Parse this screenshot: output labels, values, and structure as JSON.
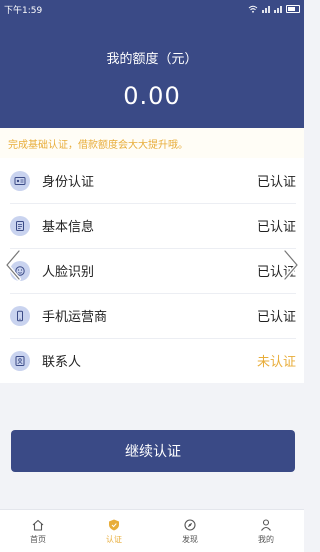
{
  "status_bar": {
    "time": "下午1:59"
  },
  "header": {
    "quota_label": "我的额度（元）",
    "quota_value": "0.00"
  },
  "tip": "完成基础认证，借款额度会大大提升哦。",
  "items": [
    {
      "label": "身份认证",
      "status": "已认证",
      "icon": "id-card-icon"
    },
    {
      "label": "基本信息",
      "status": "已认证",
      "icon": "document-icon"
    },
    {
      "label": "人脸识别",
      "status": "已认证",
      "icon": "face-icon"
    },
    {
      "label": "手机运营商",
      "status": "已认证",
      "icon": "phone-icon"
    },
    {
      "label": "联系人",
      "status": "未认证",
      "icon": "contacts-icon"
    }
  ],
  "continue_label": "继续认证",
  "tabs": [
    {
      "label": "首页",
      "icon": "home-icon"
    },
    {
      "label": "认证",
      "icon": "shield-icon"
    },
    {
      "label": "发现",
      "icon": "compass-icon"
    },
    {
      "label": "我的",
      "icon": "person-icon"
    }
  ],
  "colors": {
    "brand": "#3a4a86",
    "accent": "#e8ad3a",
    "icon_bg": "#c9d3ef"
  }
}
